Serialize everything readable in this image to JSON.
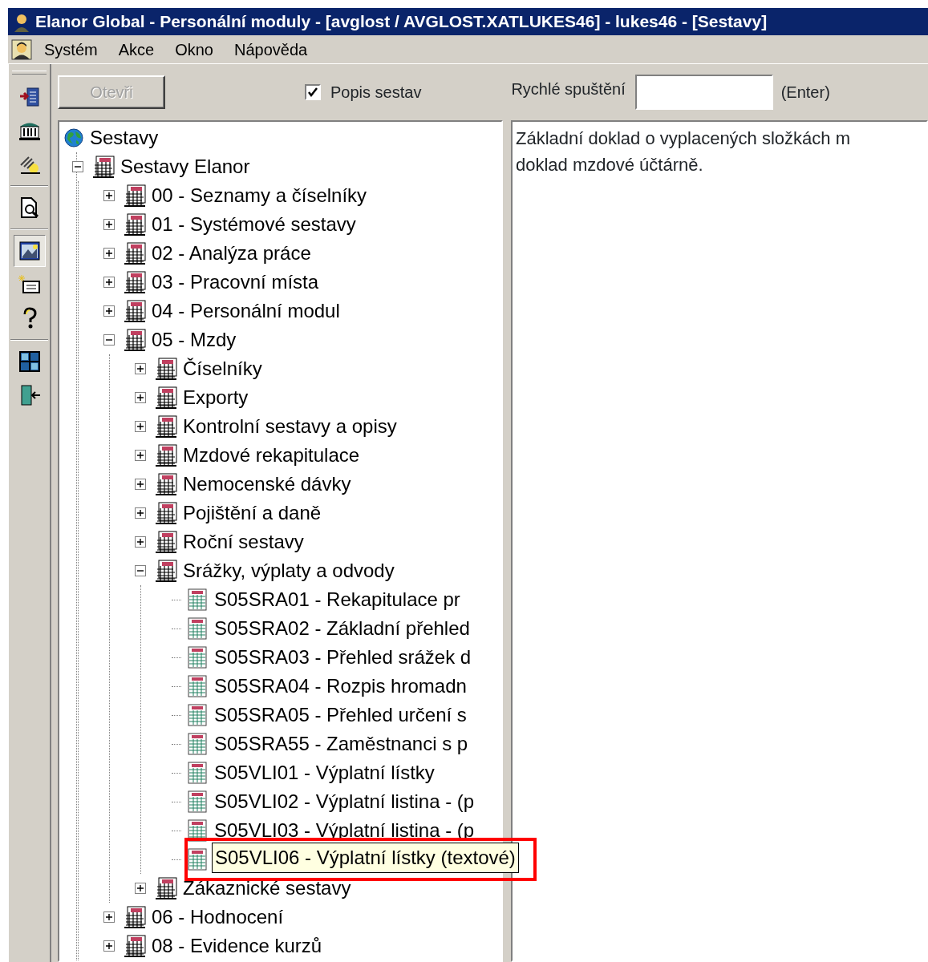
{
  "window": {
    "title": "Elanor Global - Personální moduly - [avglost / AVGLOST.XATLUKES46] - lukes46 - [Sestavy]"
  },
  "menu": [
    "Systém",
    "Akce",
    "Okno",
    "Nápověda"
  ],
  "toolbar": [
    {
      "kind": "button",
      "pressed": false
    },
    {
      "kind": "button",
      "pressed": false
    },
    {
      "kind": "button",
      "pressed": false
    },
    {
      "kind": "separator"
    },
    {
      "kind": "button",
      "pressed": false
    },
    {
      "kind": "separator"
    },
    {
      "kind": "button",
      "pressed": true
    },
    {
      "kind": "button",
      "pressed": false
    },
    {
      "kind": "button",
      "pressed": false
    },
    {
      "kind": "separator"
    },
    {
      "kind": "button",
      "pressed": false
    },
    {
      "kind": "button",
      "pressed": false
    }
  ],
  "open_button": {
    "label": "Otevři",
    "disabled": true
  },
  "description_checkbox": {
    "label": "Popis sestav",
    "checked": true
  },
  "quick_launch": {
    "label": "Rychlé spuštění",
    "hint": "(Enter)"
  },
  "tree": {
    "kind": "root",
    "label": "Sestavy",
    "children": [
      {
        "kind": "folder",
        "label": "Sestavy Elanor",
        "expanded": true,
        "children": [
          {
            "kind": "folder",
            "label": "00 - Seznamy a číselníky",
            "expanded": false
          },
          {
            "kind": "folder",
            "label": "01 - Systémové sestavy",
            "expanded": false
          },
          {
            "kind": "folder",
            "label": "02 - Analýza práce",
            "expanded": false
          },
          {
            "kind": "folder",
            "label": "03 - Pracovní místa",
            "expanded": false
          },
          {
            "kind": "folder",
            "label": "04 - Personální modul",
            "expanded": false
          },
          {
            "kind": "folder",
            "label": "05 - Mzdy",
            "expanded": true,
            "children": [
              {
                "kind": "folder",
                "label": "Číselníky",
                "expanded": false
              },
              {
                "kind": "folder",
                "label": "Exporty",
                "expanded": false
              },
              {
                "kind": "folder",
                "label": "Kontrolní sestavy a opisy",
                "expanded": false
              },
              {
                "kind": "folder",
                "label": "Mzdové rekapitulace",
                "expanded": false
              },
              {
                "kind": "folder",
                "label": "Nemocenské dávky",
                "expanded": false
              },
              {
                "kind": "folder",
                "label": "Pojištění a daně",
                "expanded": false
              },
              {
                "kind": "folder",
                "label": "Roční sestavy",
                "expanded": false
              },
              {
                "kind": "folder",
                "label": "Srážky, výplaty a odvody",
                "expanded": true,
                "children": [
                  {
                    "kind": "report",
                    "label": "S05SRA01 - Rekapitulace pr"
                  },
                  {
                    "kind": "report",
                    "label": "S05SRA02 - Základní přehled"
                  },
                  {
                    "kind": "report",
                    "label": "S05SRA03 - Přehled srážek d"
                  },
                  {
                    "kind": "report",
                    "label": "S05SRA04 - Rozpis hromadn"
                  },
                  {
                    "kind": "report",
                    "label": "S05SRA05 - Přehled určení s"
                  },
                  {
                    "kind": "report",
                    "label": "S05SRA55 - Zaměstnanci s p"
                  },
                  {
                    "kind": "report",
                    "label": "S05VLI01 - Výplatní lístky"
                  },
                  {
                    "kind": "report",
                    "label": "S05VLI02 - Výplatní listina - (p"
                  },
                  {
                    "kind": "report",
                    "label": "S05VLI03 - Výplatní listina - (p"
                  },
                  {
                    "kind": "report",
                    "label": "S05VLI06 - Výplatní lístky (textové)",
                    "tooltip": true,
                    "highlight": true
                  }
                ]
              },
              {
                "kind": "folder",
                "label": "Zákaznické sestavy",
                "expanded": false
              }
            ]
          },
          {
            "kind": "folder",
            "label": "06 - Hodnocení",
            "expanded": false
          },
          {
            "kind": "folder",
            "label": "08 - Evidence kurzů",
            "expanded": false
          }
        ]
      }
    ]
  },
  "description": [
    "Základní doklad o vyplacených složkách m",
    "doklad mzdové účtárně."
  ]
}
